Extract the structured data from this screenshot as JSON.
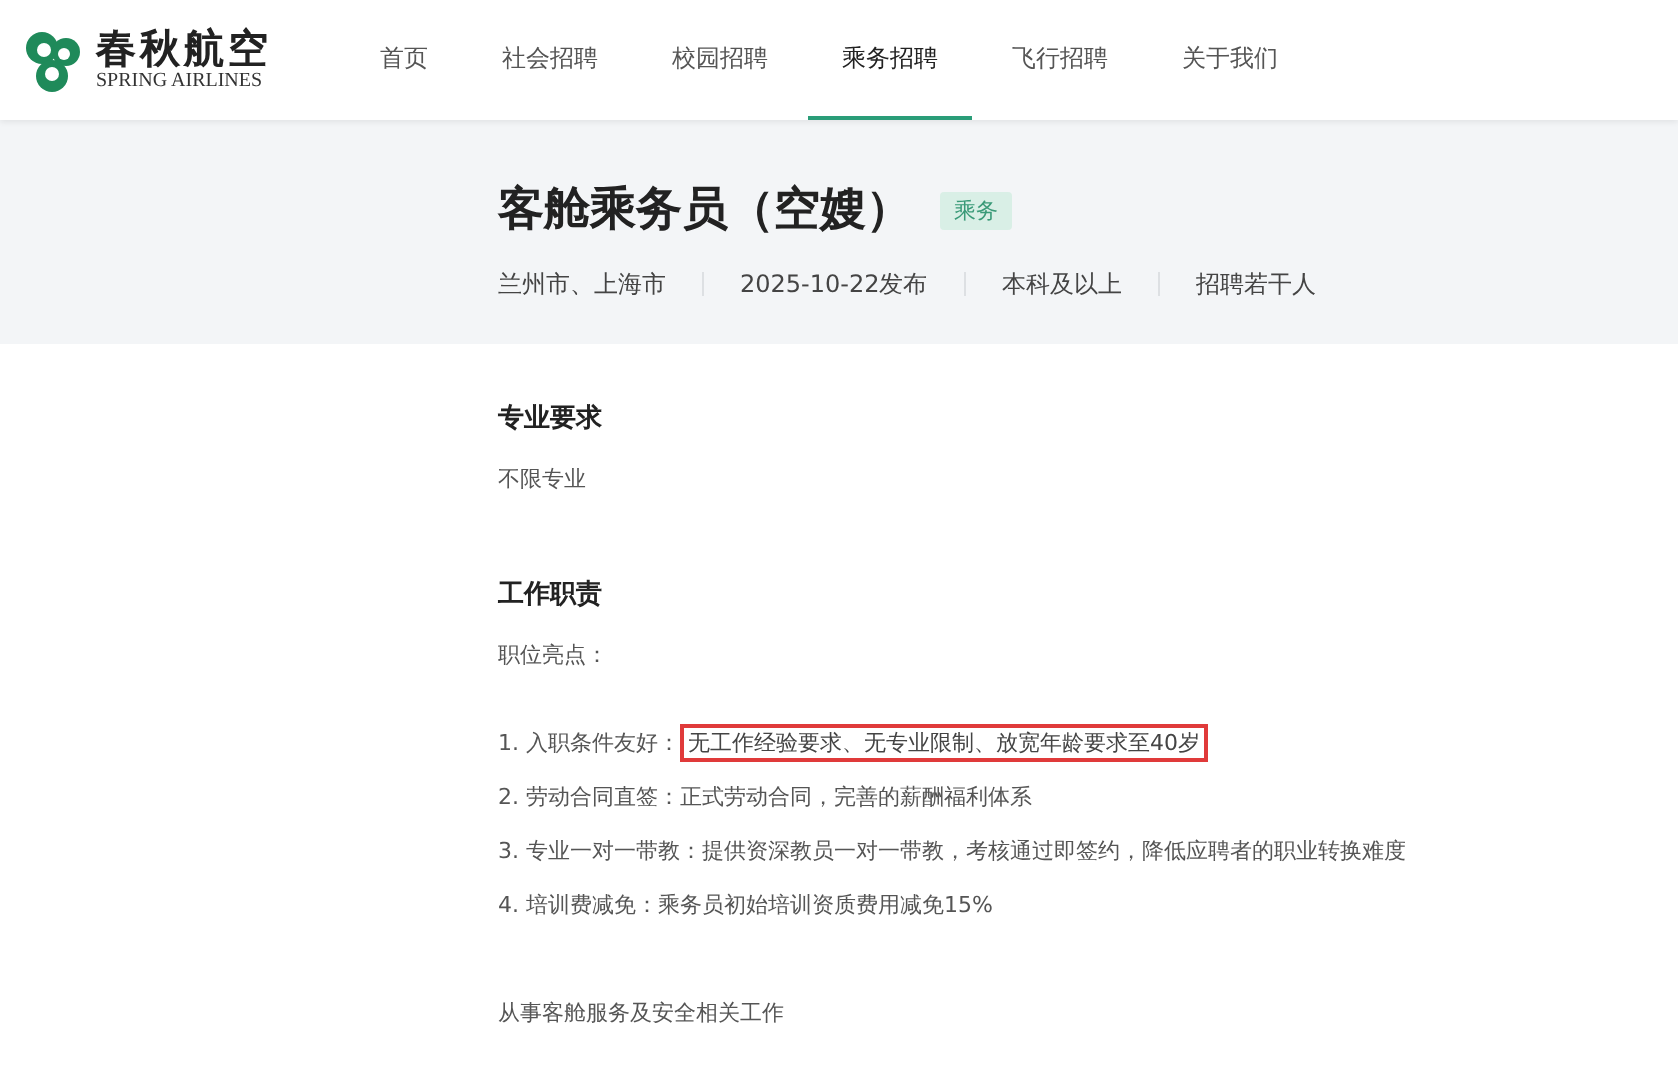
{
  "logo": {
    "name": "春秋航空",
    "subtitle": "SPRING AIRLINES"
  },
  "nav": [
    {
      "label": "首页",
      "selected": false
    },
    {
      "label": "社会招聘",
      "selected": false
    },
    {
      "label": "校园招聘",
      "selected": false
    },
    {
      "label": "乘务招聘",
      "selected": true
    },
    {
      "label": "飞行招聘",
      "selected": false
    },
    {
      "label": "关于我们",
      "selected": false
    }
  ],
  "job": {
    "title": "客舱乘务员（空嫂）",
    "tag": "乘务",
    "meta": [
      "兰州市、上海市",
      "2025-10-22发布",
      "本科及以上",
      "招聘若干人"
    ]
  },
  "sections": [
    {
      "heading": "专业要求",
      "paragraphs": [
        "不限专业"
      ]
    },
    {
      "heading": "工作职责",
      "intro": "职位亮点：",
      "items": [
        {
          "lead": "1. 入职条件友好：",
          "text": "无工作经验要求、无专业限制、放宽年龄要求至40岁",
          "highlighted": true
        },
        {
          "lead": "2. 劳动合同直签：",
          "text": "正式劳动合同，完善的薪酬福利体系",
          "highlighted": false
        },
        {
          "lead": "3. 专业一对一带教：",
          "text": "提供资深教员一对一带教，考核通过即签约，降低应聘者的职业转换难度",
          "highlighted": false
        },
        {
          "lead": "4. 培训费减免：",
          "text": "乘务员初始培训资质费用减免15%",
          "highlighted": false
        }
      ],
      "paragraphs": [
        "从事客舱服务及安全相关工作"
      ]
    }
  ]
}
